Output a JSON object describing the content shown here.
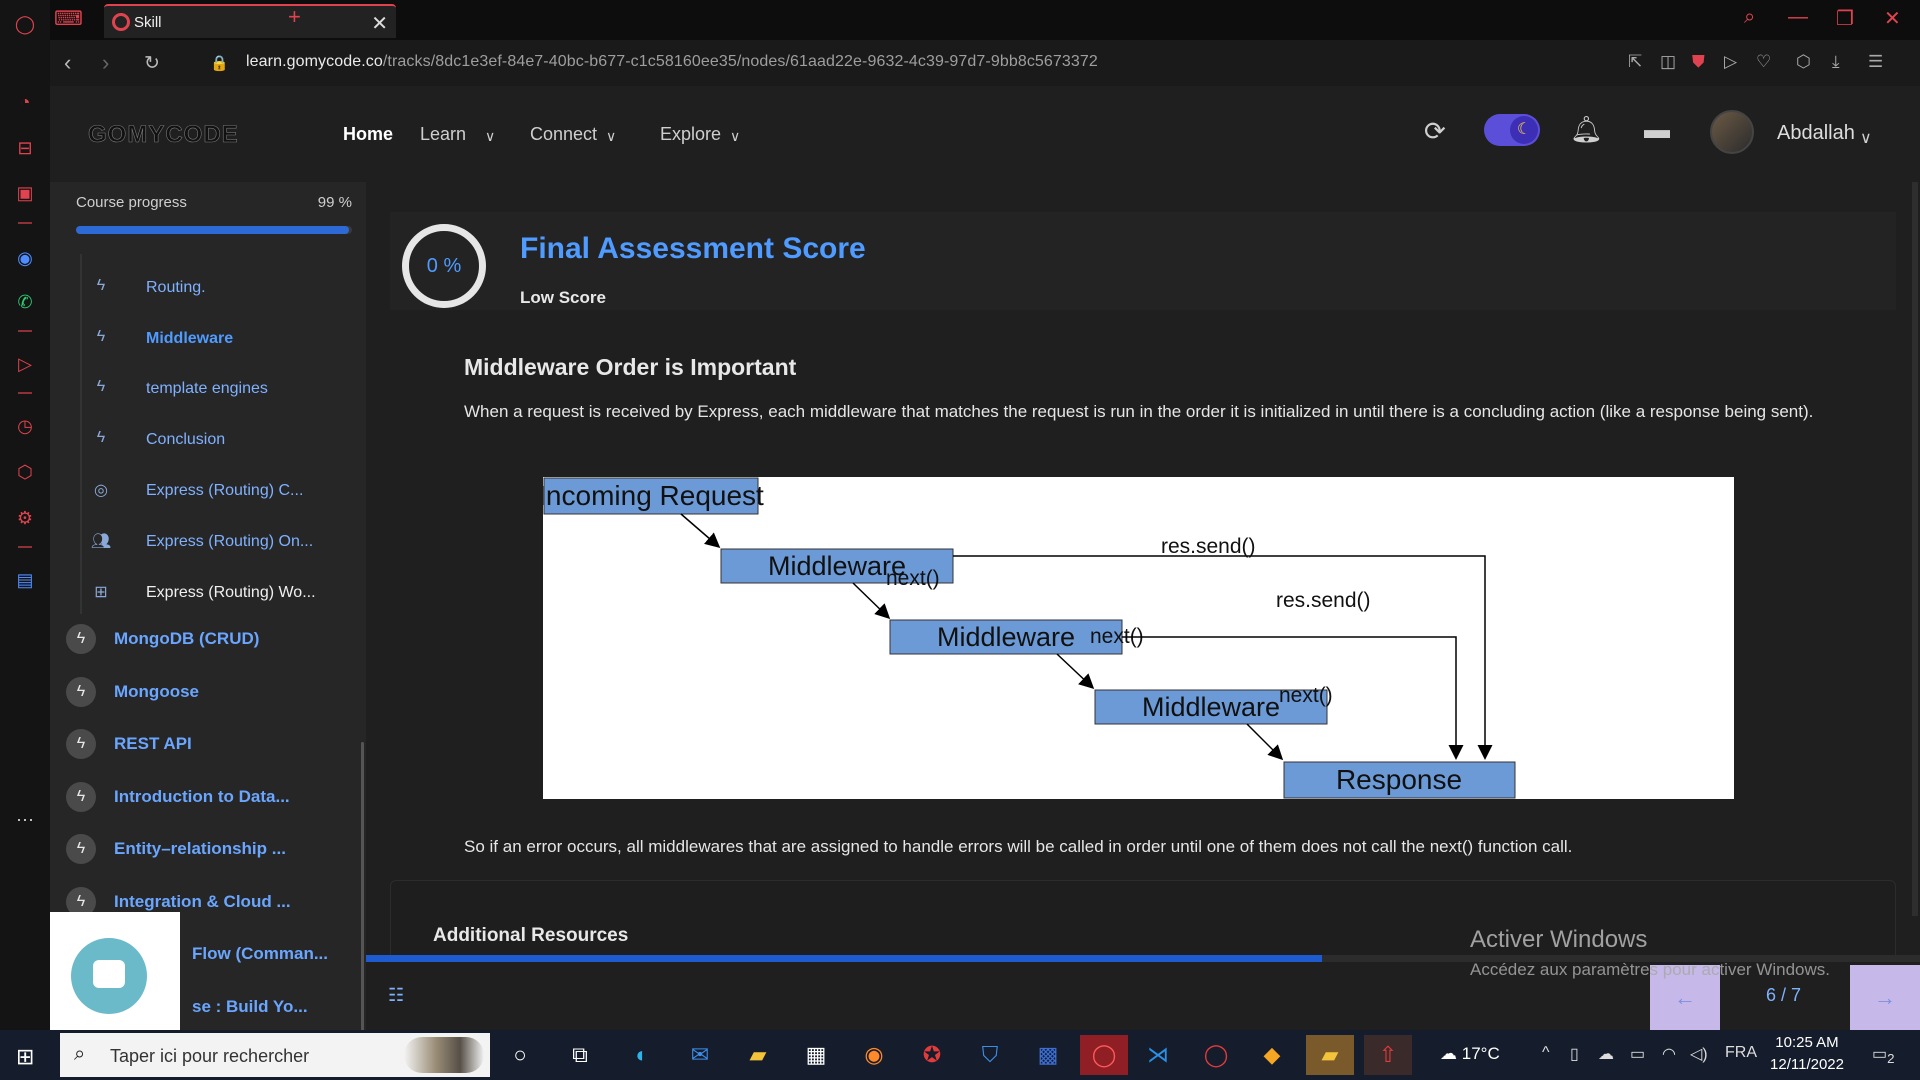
{
  "browser": {
    "tab_title": "Skill",
    "url_domain": "learn.gomycode.co",
    "url_path": "/tracks/8dc1e3ef-84e7-40bc-b677-c1c58160ee35/nodes/61aad22e-9632-4c39-97d7-9bb8c5673372"
  },
  "header": {
    "logo": "GOMYCODE",
    "nav": [
      "Home",
      "Learn",
      "Connect",
      "Explore"
    ],
    "user_name": "Abdallah"
  },
  "sidebar": {
    "progress_label": "Course progress",
    "progress_value": "99 %",
    "progress_fraction": 0.99,
    "sub_items": [
      {
        "label": "Routing.",
        "icon": "bolt-icon"
      },
      {
        "label": "Middleware",
        "icon": "bolt-icon"
      },
      {
        "label": "template engines",
        "icon": "bolt-icon"
      },
      {
        "label": "Conclusion",
        "icon": "bolt-icon"
      },
      {
        "label": "Express (Routing) C...",
        "icon": "target-icon"
      },
      {
        "label": "Express (Routing) On...",
        "icon": "people-icon"
      },
      {
        "label": "Express (Routing) Wo...",
        "icon": "board-icon"
      }
    ],
    "modules": [
      "MongoDB (CRUD)",
      "Mongoose",
      "REST API",
      "Introduction to Data...",
      "Entity–relationship ...",
      "Integration & Cloud ...",
      "Flow (Comman...",
      "se : Build Yo..."
    ]
  },
  "content": {
    "score_value": "0 %",
    "score_title": "Final Assessment Score",
    "score_sub": "Low Score",
    "section_title": "Middleware Order is Important",
    "paragraph": "When a request is received by Express, each middleware that matches the request is run in the order it is initialized in until there is a concluding action (like a response being sent).",
    "diagram": {
      "incoming": "Incoming Request",
      "mw1": "Middleware",
      "mw2": "Middleware",
      "mw3": "Middleware",
      "response": "Response",
      "next1": "next()",
      "next2": "next()",
      "next3": "next()",
      "send1": "res.send()",
      "send2": "res.send()"
    },
    "after_paragraph": "So if an error occurs, all middlewares that are assigned to handle errors will be called in order until one of them does not call the next() function call.",
    "resources_title": "Additional Resources"
  },
  "footer": {
    "pager": "6 / 7",
    "progress_fraction": 0.615,
    "prev": "←",
    "next": "→"
  },
  "windows_watermark": {
    "line1": "Activer Windows",
    "line2": "Accédez aux paramètres pour activer Windows."
  },
  "taskbar": {
    "search_placeholder": "Taper ici pour rechercher",
    "weather": "17°C",
    "lang": "FRA",
    "time": "10:25 AM",
    "date": "12/11/2022",
    "notif_count": "2"
  }
}
